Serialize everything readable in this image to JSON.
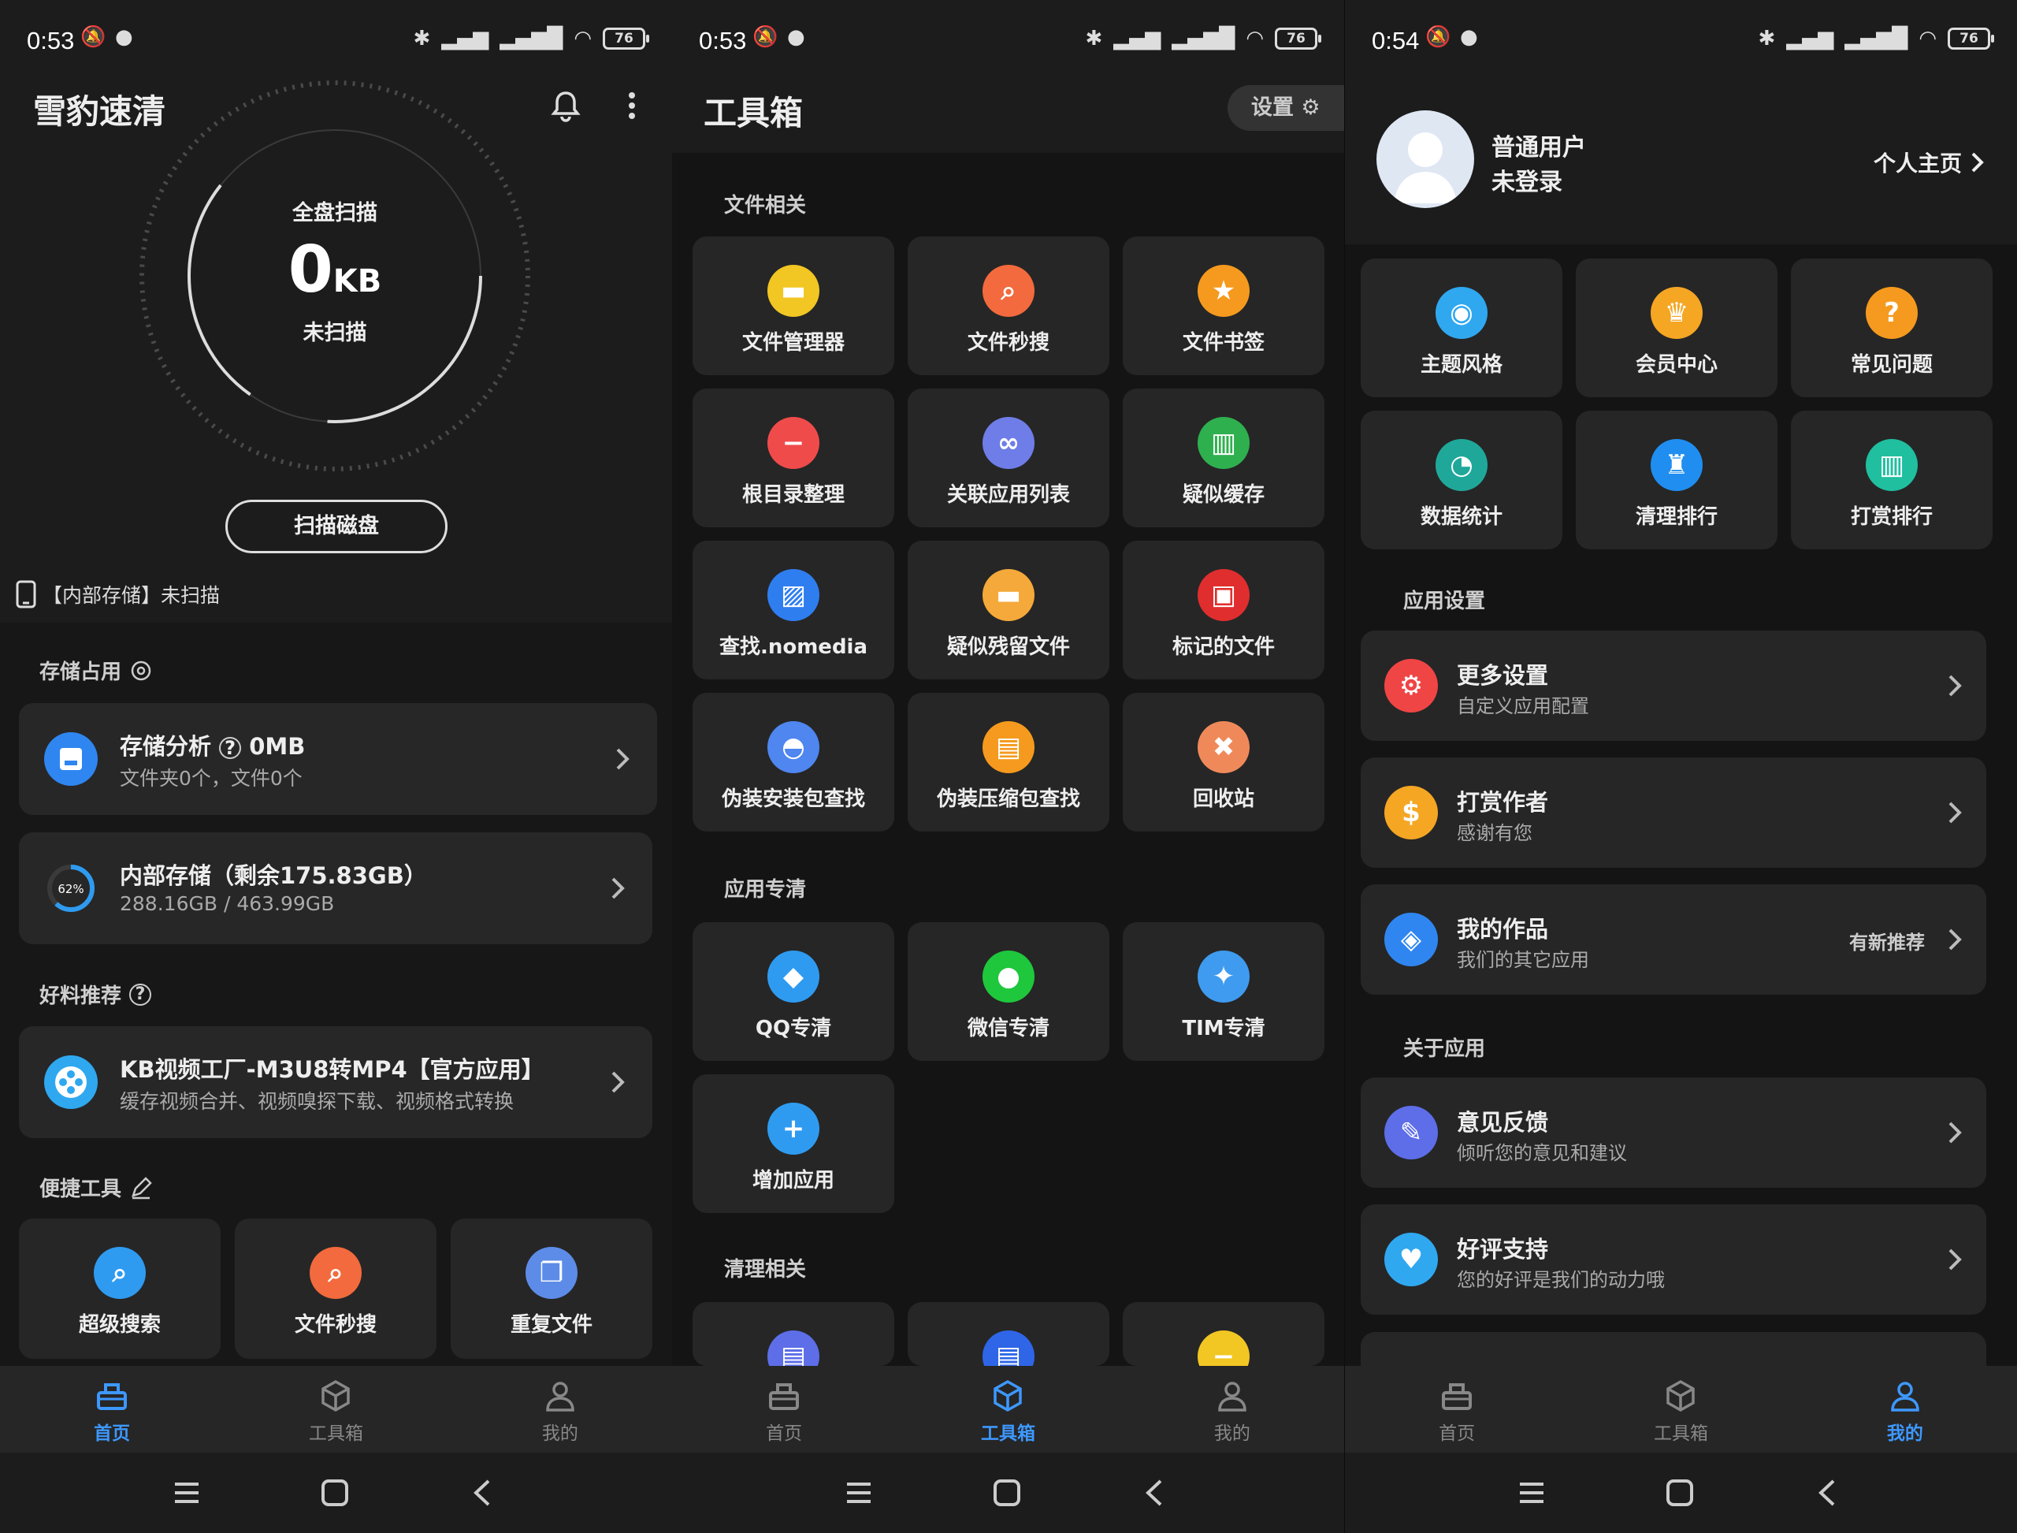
{
  "colors": {
    "accent": "#3d98ff",
    "background": "#1c1c1c",
    "card": "#272727"
  },
  "phone1": {
    "status": {
      "time": "0:53",
      "battery": "76"
    },
    "title": "雪豹速清",
    "scan": {
      "heading": "全盘扫描",
      "value": "0",
      "unit": "KB",
      "state": "未扫描"
    },
    "scan_button": "扫描磁盘",
    "internal_storage": "【内部存储】未扫描",
    "section_storage": "存储占用",
    "storage_analysis": {
      "title": "存储分析",
      "size": "0MB",
      "sub": "文件夹0个，文件0个"
    },
    "internal": {
      "title": "内部存储（剩余175.83GB）",
      "sub": "288.16GB / 463.99GB",
      "percent": "62%",
      "percent_value": 62
    },
    "section_recommend": "好料推荐",
    "recommend": {
      "title": "KB视频工厂-M3U8转MP4【官方应用】",
      "sub": "缓存视频合并、视频嗅探下载、视频格式转换"
    },
    "section_quick": "便捷工具",
    "quick_tools": [
      {
        "label": "超级搜索",
        "icon": "search-icon",
        "color": "#2f9bf0"
      },
      {
        "label": "文件秒搜",
        "icon": "search-icon",
        "color": "#f26a3d"
      },
      {
        "label": "重复文件",
        "icon": "file-copy-icon",
        "color": "#5d8ce8"
      }
    ]
  },
  "phone2": {
    "status": {
      "time": "0:53",
      "battery": "76"
    },
    "title": "工具箱",
    "settings": "设置",
    "sections": [
      "文件相关",
      "应用专清",
      "清理相关"
    ],
    "file_tools": [
      {
        "label": "文件管理器",
        "icon": "folder-icon",
        "color": "#f2c623"
      },
      {
        "label": "文件秒搜",
        "icon": "search-icon",
        "color": "#f26a3d"
      },
      {
        "label": "文件书签",
        "icon": "bookmark-icon",
        "color": "#f59a1e"
      },
      {
        "label": "根目录整理",
        "icon": "folder-minus-icon",
        "color": "#f04b4b"
      },
      {
        "label": "关联应用列表",
        "icon": "link-icon",
        "color": "#6f7de8"
      },
      {
        "label": "疑似缓存",
        "icon": "basket-icon",
        "color": "#2fb04f"
      },
      {
        "label": "查找.nomedia",
        "icon": "image-icon",
        "color": "#2f7ef0"
      },
      {
        "label": "疑似残留文件",
        "icon": "folder-icon",
        "color": "#f5a93a"
      },
      {
        "label": "标记的文件",
        "icon": "file-mark-icon",
        "color": "#e02e2e"
      },
      {
        "label": "伪装安装包查找",
        "icon": "android-icon",
        "color": "#4f86f0"
      },
      {
        "label": "伪装压缩包查找",
        "icon": "zip-icon",
        "color": "#f59a1e"
      },
      {
        "label": "回收站",
        "icon": "trash-icon",
        "color": "#f0895a"
      }
    ],
    "app_tools": [
      {
        "label": "QQ专清",
        "icon": "qq-icon",
        "color": "#2f9bf0"
      },
      {
        "label": "微信专清",
        "icon": "wechat-icon",
        "color": "#1fc73c"
      },
      {
        "label": "TIM专清",
        "icon": "tim-icon",
        "color": "#3f9bf0"
      },
      {
        "label": "增加应用",
        "icon": "plus-icon",
        "color": "#2f9bf0"
      }
    ],
    "clean_tools": [
      {
        "icon": "doc-icon",
        "color": "#5d6ee8"
      },
      {
        "icon": "zip-icon",
        "color": "#2f66e8"
      },
      {
        "icon": "minus-icon",
        "color": "#f2c623"
      }
    ]
  },
  "phone3": {
    "status": {
      "time": "0:54",
      "battery": "76"
    },
    "user": {
      "name": "普通用户",
      "login": "未登录",
      "home": "个人主页"
    },
    "grid": [
      {
        "label": "主题风格",
        "icon": "palette-icon",
        "color": "#2fa8f0"
      },
      {
        "label": "会员中心",
        "icon": "crown-icon",
        "color": "#f5a623"
      },
      {
        "label": "常见问题",
        "icon": "help-icon",
        "color": "#f59a1e"
      },
      {
        "label": "数据统计",
        "icon": "pie-chart-icon",
        "color": "#1fa89a"
      },
      {
        "label": "清理排行",
        "icon": "trophy-icon",
        "color": "#1f8ef0"
      },
      {
        "label": "打赏排行",
        "icon": "rank-icon",
        "color": "#1fbfa0"
      }
    ],
    "section_settings": "应用设置",
    "settings": [
      {
        "title": "更多设置",
        "sub": "自定义应用配置",
        "icon": "gear-icon",
        "color": "#f04545",
        "extra": ""
      },
      {
        "title": "打赏作者",
        "sub": "感谢有您",
        "icon": "money-bag-icon",
        "color": "#f5a623",
        "extra": ""
      },
      {
        "title": "我的作品",
        "sub": "我们的其它应用",
        "icon": "layers-icon",
        "color": "#2f86f0",
        "extra": "有新推荐"
      }
    ],
    "section_about": "关于应用",
    "about": [
      {
        "title": "意见反馈",
        "sub": "倾听您的意见和建议",
        "icon": "edit-icon",
        "color": "#5d6ee8"
      },
      {
        "title": "好评支持",
        "sub": "您的好评是我们的动力哦",
        "icon": "thumb-up-icon",
        "color": "#2fa8f0"
      }
    ]
  },
  "nav": {
    "home": "首页",
    "toolbox": "工具箱",
    "me": "我的"
  }
}
